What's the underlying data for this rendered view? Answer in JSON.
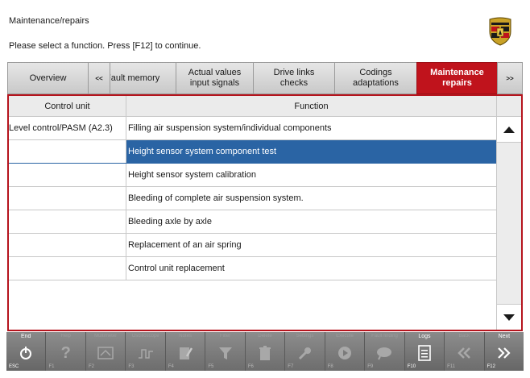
{
  "header": {
    "title": "Maintenance/repairs",
    "instruction": "Please select a function. Press [F12] to continue."
  },
  "tabs": [
    {
      "label": "Overview",
      "state": "normal"
    },
    {
      "label": "<<",
      "state": "normal"
    },
    {
      "label": "Fault memory",
      "state": "normal"
    },
    {
      "label": "Actual values\ninput signals",
      "state": "normal"
    },
    {
      "label": "Drive links\nchecks",
      "state": "normal"
    },
    {
      "label": "Codings\nadaptations",
      "state": "normal"
    },
    {
      "label": "Maintenance\nrepairs",
      "state": "active"
    },
    {
      "label": ">>",
      "state": "normal"
    }
  ],
  "table": {
    "columns": [
      "Control unit",
      "Function"
    ],
    "rows": [
      {
        "control_unit": "Level control/PASM (A2.3)",
        "function": "Filling air suspension system/individual components"
      },
      {
        "control_unit": "",
        "function": "Height sensor system component test",
        "selected": true
      },
      {
        "control_unit": "",
        "function": "Height sensor system calibration"
      },
      {
        "control_unit": "",
        "function": "Bleeding of complete air suspension system."
      },
      {
        "control_unit": "",
        "function": "Bleeding axle by axle"
      },
      {
        "control_unit": "",
        "function": "Replacement of an air spring"
      },
      {
        "control_unit": "",
        "function": "Control unit replacement"
      }
    ]
  },
  "function_keys": [
    {
      "label": "End",
      "code": "ESC",
      "icon": "power-icon",
      "enabled": true
    },
    {
      "label": "Help",
      "code": "F1",
      "icon": "question-icon",
      "enabled": false
    },
    {
      "label": "Multimeter",
      "code": "F2",
      "icon": "multimeter-icon",
      "enabled": false
    },
    {
      "label": "Oscilloscope",
      "code": "F3",
      "icon": "oscilloscope-icon",
      "enabled": false
    },
    {
      "label": "Notes",
      "code": "F4",
      "icon": "notes-icon",
      "enabled": false
    },
    {
      "label": "Filter",
      "code": "F5",
      "icon": "filter-icon",
      "enabled": false
    },
    {
      "label": "Delete",
      "code": "F6",
      "icon": "trash-icon",
      "enabled": false
    },
    {
      "label": "Settings",
      "code": "F7",
      "icon": "wrench-icon",
      "enabled": false
    },
    {
      "label": "Execute",
      "code": "F8",
      "icon": "play-icon",
      "enabled": false
    },
    {
      "label": "Fault finding",
      "code": "F9",
      "icon": "fault-finding-icon",
      "enabled": false
    },
    {
      "label": "Logs",
      "code": "F10",
      "icon": "log-icon",
      "enabled": true
    },
    {
      "label": "Back",
      "code": "F11",
      "icon": "back-icon",
      "enabled": false
    },
    {
      "label": "Next",
      "code": "F12",
      "icon": "next-icon",
      "enabled": true
    }
  ],
  "colors": {
    "accent": "#c0131c",
    "selection": "#2a64a4",
    "fbar": "#7a7a7a"
  }
}
